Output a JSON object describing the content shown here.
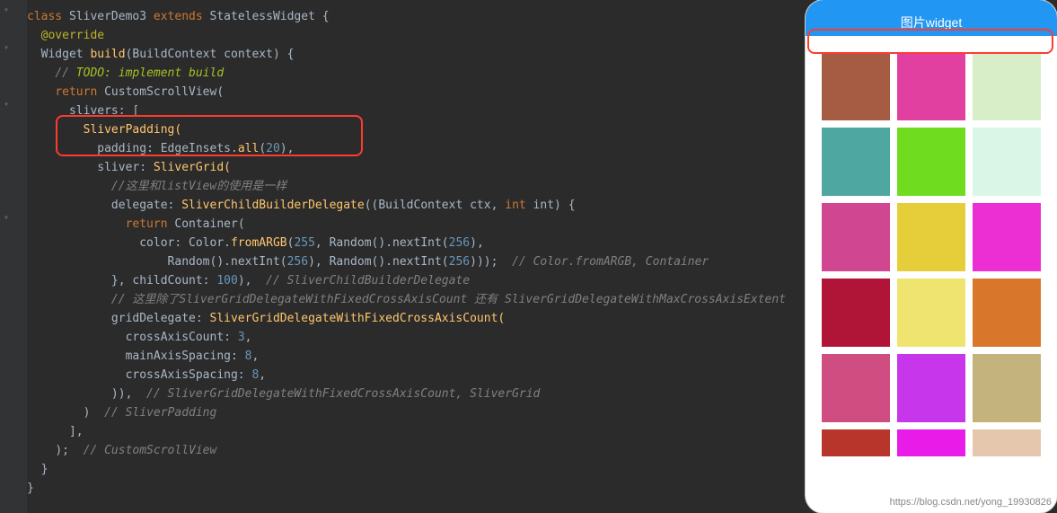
{
  "code": {
    "l1_kw_class": "class",
    "l1_name": "SliverDemo3",
    "l1_kw_extends": "extends",
    "l1_super": "StatelessWidget",
    "l1_brace": " {",
    "l2_ann": "@override",
    "l3_type": "Widget",
    "l3_fn": "build",
    "l3_sig": "(BuildContext context) {",
    "l4_cmt": "// ",
    "l4_todo": "TODO: implement build",
    "l5_kw": "return",
    "l5_call": " CustomScrollView(",
    "l6": "slivers: [",
    "l7": "SliverPadding(",
    "l8a": "padding: EdgeInsets.",
    "l8fn": "all",
    "l8b": "(",
    "l8n": "20",
    "l8c": "),",
    "l9a": "sliver: ",
    "l9b": "SliverGrid(",
    "l10": "//这里和listView的使用是一样",
    "l11a": "delegate: ",
    "l11b": "SliverChildBuilderDelegate",
    "l11c": "((BuildContext ctx, ",
    "l11d": "int",
    "l11e": " int) {",
    "l12a": "return",
    "l12b": " Container(",
    "l13a": "color: Color.",
    "l13fn": "fromARGB",
    "l13b": "(",
    "l13n1": "255",
    "l13c": ", ",
    "l13d": "Random().nextInt(",
    "l13n2": "256",
    "l13e": "),",
    "l14a": "Random().nextInt(",
    "l14n1": "256",
    "l14b": "), Random().nextInt(",
    "l14n2": "256",
    "l14c": ")));",
    "l14cmt": "  // Color.fromARGB, Container",
    "l15a": "}, childCount: ",
    "l15n": "100",
    "l15b": "),",
    "l15cmt": "  // SliverChildBuilderDelegate",
    "l16cmt": "// 这里除了SliverGridDelegateWithFixedCrossAxisCount 还有 SliverGridDelegateWithMaxCrossAxisExtent",
    "l17a": "gridDelegate: ",
    "l17b": "SliverGridDelegateWithFixedCrossAxisCount(",
    "l18a": "crossAxisCount: ",
    "l18n": "3",
    "l18b": ",",
    "l19a": "mainAxisSpacing: ",
    "l19n": "8",
    "l19b": ",",
    "l20a": "crossAxisSpacing: ",
    "l20n": "8",
    "l20b": ",",
    "l21a": ")),",
    "l21cmt": "  // SliverGridDelegateWithFixedCrossAxisCount, SliverGrid",
    "l22a": ")",
    "l22cmt": "  // SliverPadding",
    "l23": "],",
    "l24a": ");",
    "l24cmt": "  // CustomScrollView",
    "l25": "}",
    "l26": "}"
  },
  "phone": {
    "title": "图片widget",
    "colors": [
      "#a65b43",
      "#e240a1",
      "#d8eec9",
      "#4ea7a0",
      "#6fdc1f",
      "#d9f6e6",
      "#d14690",
      "#e6cd3a",
      "#ec2fd2",
      "#b01538",
      "#f0e470",
      "#d8772b",
      "#d04d82",
      "#c836ec",
      "#c4b37d",
      "#b8352b",
      "#e81be8",
      "#e4c7ad"
    ]
  },
  "watermark": "https://blog.csdn.net/yong_19930826"
}
